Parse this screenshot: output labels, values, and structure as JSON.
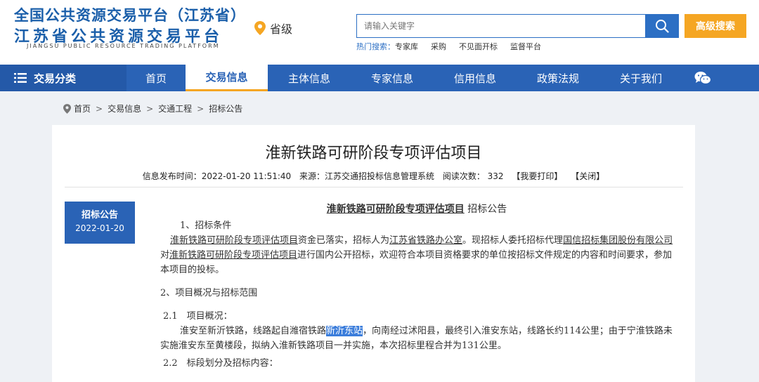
{
  "header": {
    "logo_line1": "全国公共资源交易平台（江苏省）",
    "logo_line2": "江苏省公共资源交易平台",
    "logo_en": "JIANGSU PUBLIC RESOURCE TRADING PLATFORM",
    "province": "省级",
    "search_placeholder": "请输入关键字",
    "advanced_search": "高级搜索",
    "hot_label": "热门搜索：",
    "hot_items": [
      "专家库",
      "采购",
      "不见面开标",
      "监督平台"
    ]
  },
  "nav": {
    "category": "交易分类",
    "items": [
      "首页",
      "交易信息",
      "主体信息",
      "专家信息",
      "信用信息",
      "政策法规",
      "关于我们"
    ],
    "active_index": 1
  },
  "breadcrumb": [
    "首页",
    "交易信息",
    "交通工程",
    "招标公告"
  ],
  "article": {
    "title": "淮新铁路可研阶段专项评估项目",
    "meta": {
      "publish": "信息发布时间：2022-01-20 11:51:40",
      "source": "来源：江苏交通招投标信息管理系统",
      "views": "阅读次数： 332",
      "print": "【我要打印】",
      "close": "【关闭】"
    },
    "side_tag": {
      "label": "招标公告",
      "date": "2022-01-20"
    },
    "doc_head_project": "淮新铁路可研阶段专项评估项目",
    "doc_head_suffix": "招标公告",
    "s1_title": "1、招标条件",
    "s1_p_a": "淮新铁路可研阶段专项评估项目",
    "s1_p_b": "资金已落实，招标人为",
    "s1_p_c": "江苏省铁路办公室",
    "s1_p_d": "。现招标人委托招标代理",
    "s1_p_e": "国信招标集团股份有限公司",
    "s1_p_f": "对",
    "s1_p_g": "淮新铁路可研阶段专项评估项目",
    "s1_p_h": "进行国内公开招标，欢迎符合本项目资格要求的单位按招标文件规定的内容和时间要求，参加本项目的投标。",
    "s2_title": "2、项目概况与招标范围",
    "s21_title": "2.1　项目概况：",
    "s21_p_a": "淮安至新沂铁路，线路起自潍宿铁路",
    "s21_p_hl": "新沂东站",
    "s21_p_b": "，向南经过沭阳县，最终引入淮安东站，线路长约114公里；由于宁淮铁路未实施淮安东至黄楼段，拟纳入淮新铁路项目一并实施，本次招标里程合并为131公里。",
    "s22_title": "2.2　标段划分及招标内容："
  }
}
